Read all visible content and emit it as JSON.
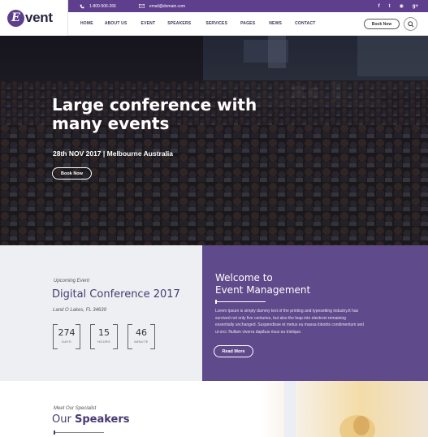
{
  "brand": {
    "logo_letter": "E",
    "logo_word": "vent",
    "primary_color": "#5e3f8d"
  },
  "topbar": {
    "phone": "1-800-506-266",
    "email": "email@domain.com",
    "social_icons": [
      "facebook-icon",
      "twitter-icon",
      "rss-icon",
      "google-plus-icon"
    ],
    "social_glyphs": [
      "f",
      "t",
      "◉",
      "g+"
    ]
  },
  "nav": {
    "items": [
      "HOME",
      "ABOUT US",
      "EVENT",
      "SPEAKERS",
      "SERVICES",
      "PAGES",
      "NEWS",
      "CONTACT"
    ],
    "book_label": "Book Now"
  },
  "hero": {
    "title": "Large conference with many events",
    "subtitle": "28th NOV 2017 | Melbourne Australia",
    "button": "Book Now"
  },
  "countdown": {
    "eyebrow": "Upcoming Event",
    "title": "Digital Conference 2017",
    "location": "Land O Lakes, FL 34639",
    "units": [
      {
        "value": "274",
        "label": "DAYS"
      },
      {
        "value": "15",
        "label": "HOURS"
      },
      {
        "value": "46",
        "label": "MINUTE"
      }
    ]
  },
  "welcome": {
    "title_line1": "Welcome to",
    "title_line2": "Event Management",
    "text": "Lorem Ipsum is simply dummy text of the printing and typesetting industry.It has survived not only five centuries, but also the leap into electroni remaining essentially unchanged. Suspendisse et metus eu massa lobortis condimentum sed ut orci. Nullam viverra dapibus risus eu tristique.",
    "button": "Read More",
    "bg_color": "#5f4a8b"
  },
  "speakers": {
    "eyebrow": "Meet Our Specialist",
    "title_prefix": "Our",
    "title_strong": "Speakers"
  }
}
